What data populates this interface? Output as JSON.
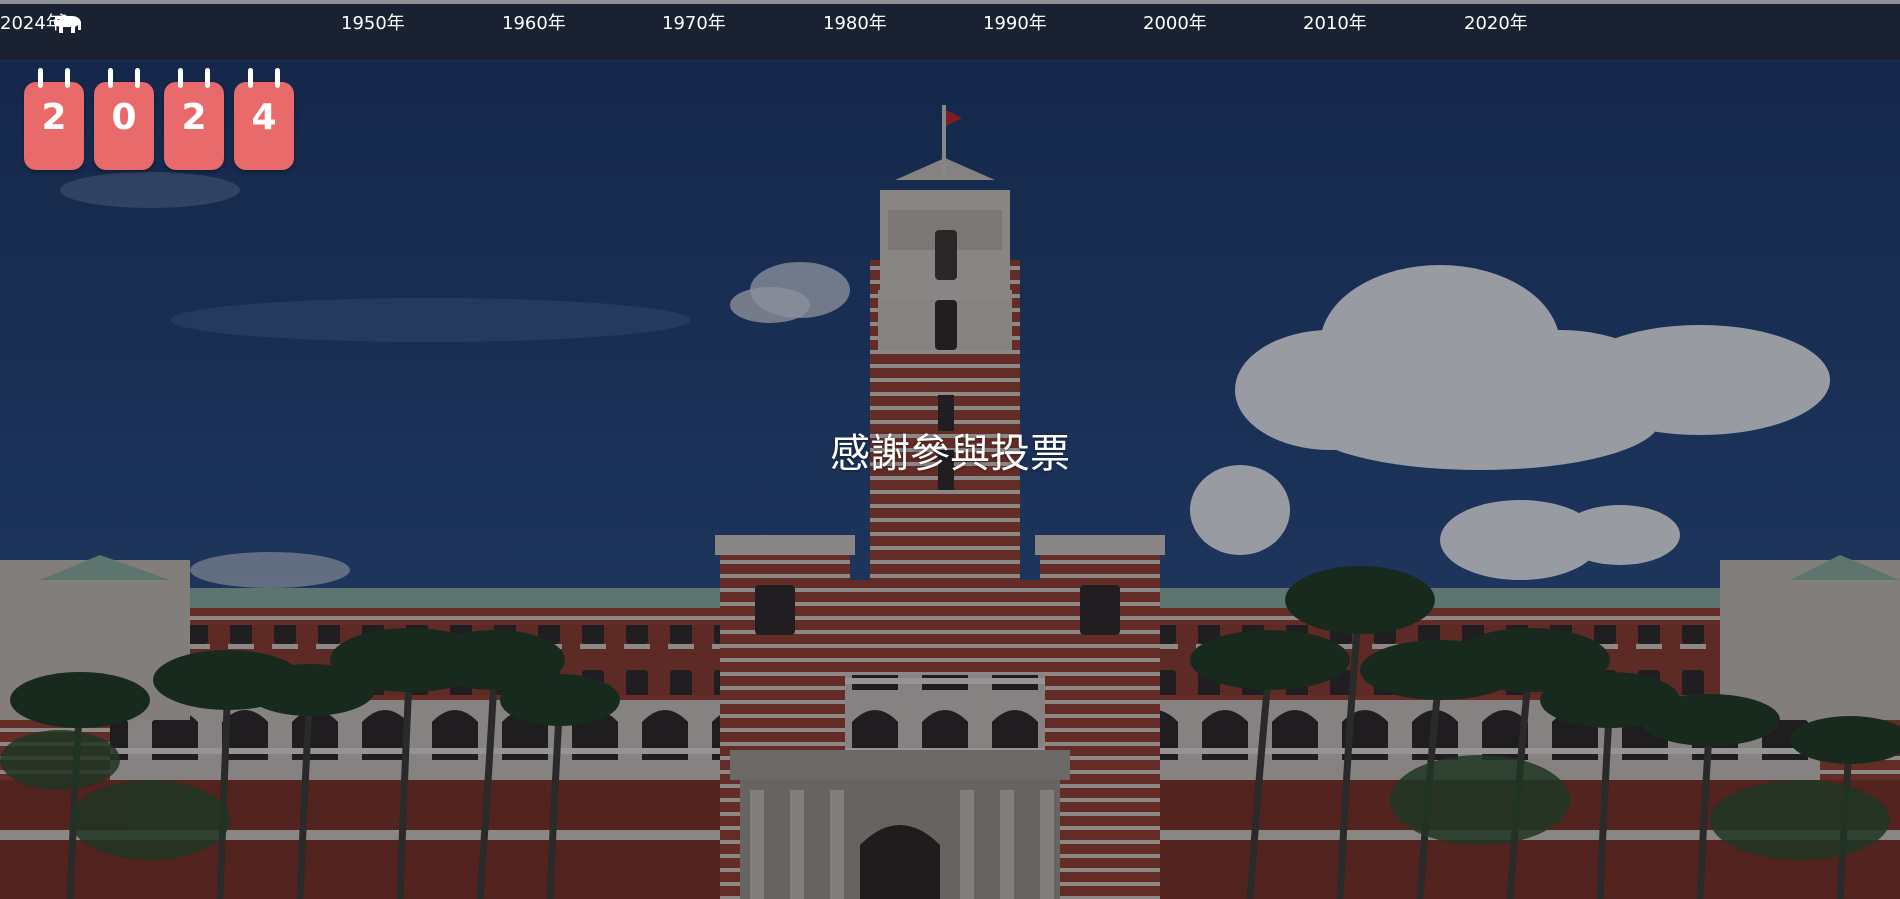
{
  "nav": {
    "logo_icon": "bear-icon",
    "items": [
      {
        "label": "1950年"
      },
      {
        "label": "1960年"
      },
      {
        "label": "1970年"
      },
      {
        "label": "1980年"
      },
      {
        "label": "1990年"
      },
      {
        "label": "2000年"
      },
      {
        "label": "2010年"
      },
      {
        "label": "2020年"
      },
      {
        "label": "2024年"
      }
    ]
  },
  "calendar": {
    "digits": [
      "2",
      "0",
      "2",
      "4"
    ],
    "card_color": "#e86a6a"
  },
  "message": "感謝參與投票",
  "colors": {
    "navbar": "#1a2231",
    "sky": "#16294a",
    "brick": "#8c3a2c"
  }
}
